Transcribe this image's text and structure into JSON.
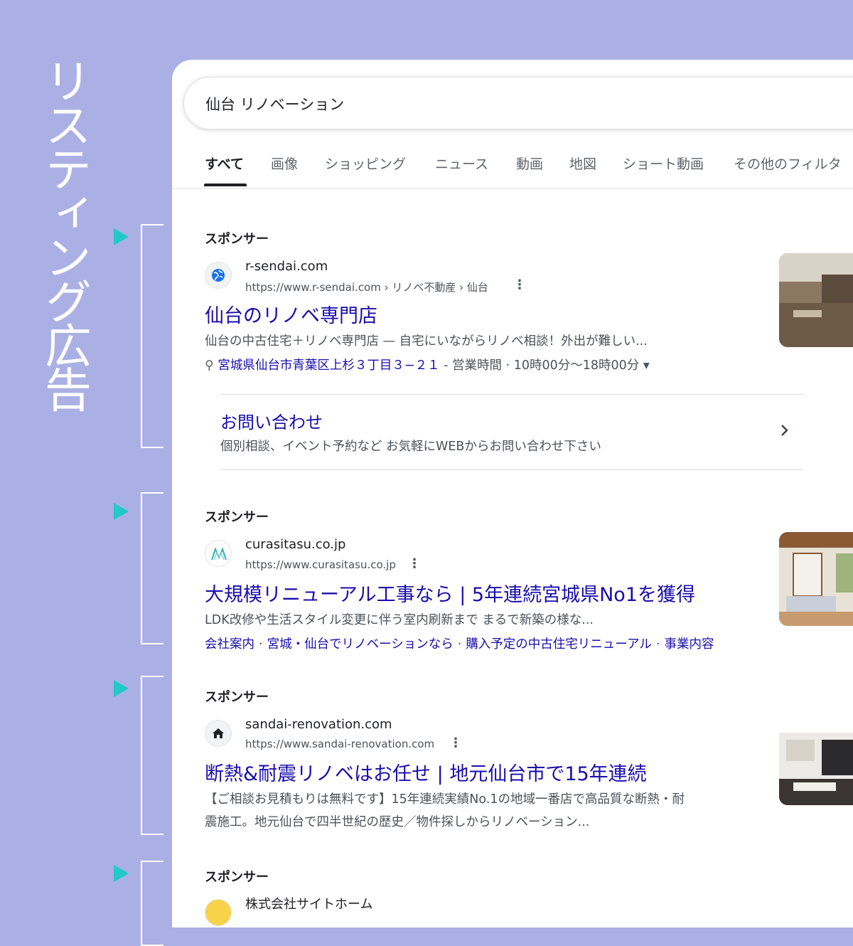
{
  "side_title": "リスティング広告",
  "search": {
    "query": "仙台 リノベーション"
  },
  "tabs": [
    "すべて",
    "画像",
    "ショッピング",
    "ニュース",
    "動画",
    "地図",
    "ショート動画",
    "その他のフィルタ"
  ],
  "ads": [
    {
      "sponsor": "スポンサー",
      "favicon": "globe-icon",
      "site": "r-sendai.com",
      "url": "https://www.r-sendai.com › リノベ不動産 › 仙台",
      "headline": "仙台のリノベ専門店",
      "description": "仙台の中古住宅＋リノベ専門店 — 自宅にいながらリノベ相談！外出が難しい...",
      "address": "宮城県仙台市青葉区上杉３丁目３−２１",
      "hours": "- 営業時間 · 10時00分〜18時00分",
      "sitelink_title": "お問い合わせ",
      "sitelink_desc": "個別相談、イベント予約など お気軽にWEBからお問い合わせ下さい"
    },
    {
      "sponsor": "スポンサー",
      "favicon": "curasitasu-logo-icon",
      "site": "curasitasu.co.jp",
      "url": "https://www.curasitasu.co.jp",
      "headline": "大規模リニューアル工事なら | 5年連続宮城県No1を獲得",
      "description": "LDK改修や生活スタイル変更に伴う室内刷新まで まるで新築の様な...",
      "links": [
        "会社案内",
        "宮城・仙台でリノベーションなら",
        "購入予定の中古住宅リニューアル",
        "事業内容"
      ]
    },
    {
      "sponsor": "スポンサー",
      "favicon": "home-icon",
      "site": "sandai-renovation.com",
      "url": "https://www.sandai-renovation.com",
      "headline": "断熱&耐震リノベはお任せ | 地元仙台市で15年連続",
      "description_1": "【ご相談お見積もりは無料です】15年連続実績No.1の地域一番店で高品質な断熱・耐",
      "description_2": "震施工。地元仙台で四半世紀の歴史／物件探しからリノベーション..."
    },
    {
      "sponsor": "スポンサー",
      "site": "株式会社サイトホーム"
    }
  ],
  "colors": {
    "background": "#abb0e4",
    "marker": "#22c9c9",
    "link": "#1a0dab"
  }
}
